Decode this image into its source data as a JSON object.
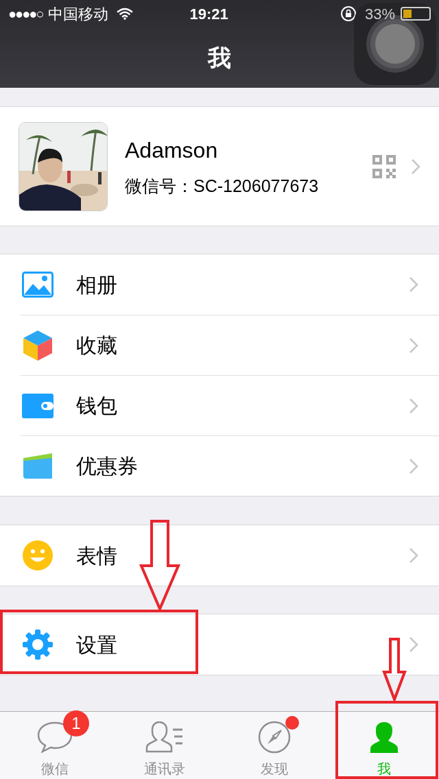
{
  "status_bar": {
    "signal_dots": "●●●●○",
    "carrier": "中国移动",
    "time": "19:21",
    "battery": "33%"
  },
  "nav": {
    "title": "我"
  },
  "profile": {
    "name": "Adamson",
    "wechat_id": "微信号：SC-1206077673"
  },
  "groups": [
    [
      {
        "label": "相册",
        "kind": "album"
      },
      {
        "label": "收藏",
        "kind": "favorites"
      },
      {
        "label": "钱包",
        "kind": "wallet"
      },
      {
        "label": "优惠券",
        "kind": "coupon"
      }
    ],
    [
      {
        "label": "表情",
        "kind": "sticker"
      }
    ],
    [
      {
        "label": "设置",
        "kind": "settings"
      }
    ]
  ],
  "tabs": [
    {
      "label": "微信",
      "kind": "chats",
      "selected": false,
      "badge": "1"
    },
    {
      "label": "通讯录",
      "kind": "contacts",
      "selected": false
    },
    {
      "label": "发现",
      "kind": "discover",
      "selected": false,
      "dot": true
    },
    {
      "label": "我",
      "kind": "me",
      "selected": true
    }
  ]
}
